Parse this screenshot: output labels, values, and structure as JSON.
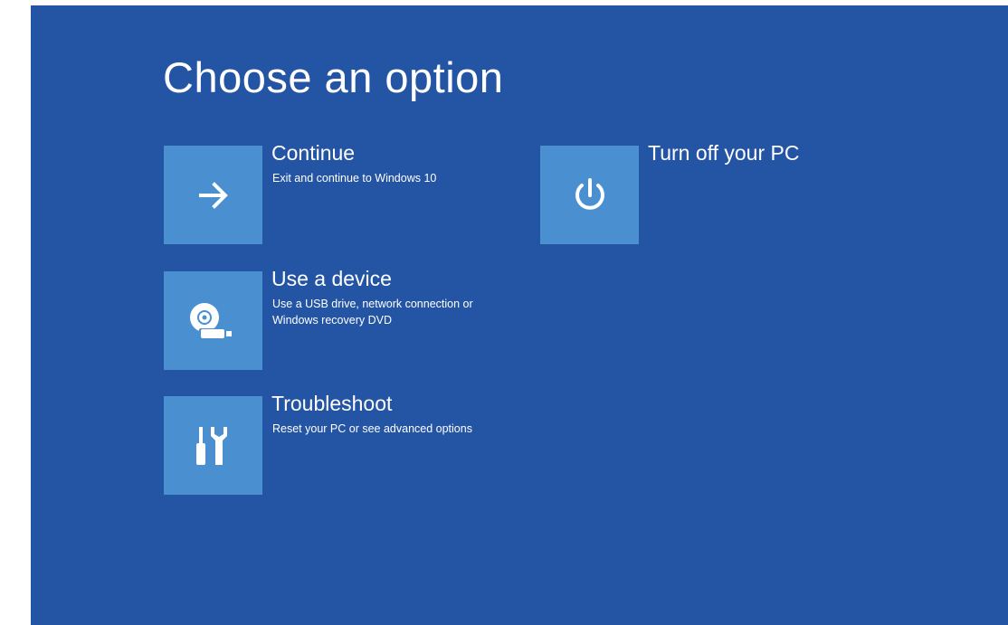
{
  "page": {
    "title": "Choose an option"
  },
  "options": [
    {
      "title": "Continue",
      "description": "Exit and continue to Windows 10",
      "icon": "arrow-right-icon"
    },
    {
      "title": "Use a device",
      "description": "Use a USB drive, network connection or Windows recovery DVD",
      "icon": "disc-usb-icon"
    },
    {
      "title": "Troubleshoot",
      "description": "Reset your PC or see advanced options",
      "icon": "tools-icon"
    },
    {
      "title": "Turn off your PC",
      "description": "",
      "icon": "power-icon"
    }
  ],
  "colors": {
    "background": "#2455a4",
    "tile": "#4a8fd0",
    "text": "#ffffff"
  }
}
